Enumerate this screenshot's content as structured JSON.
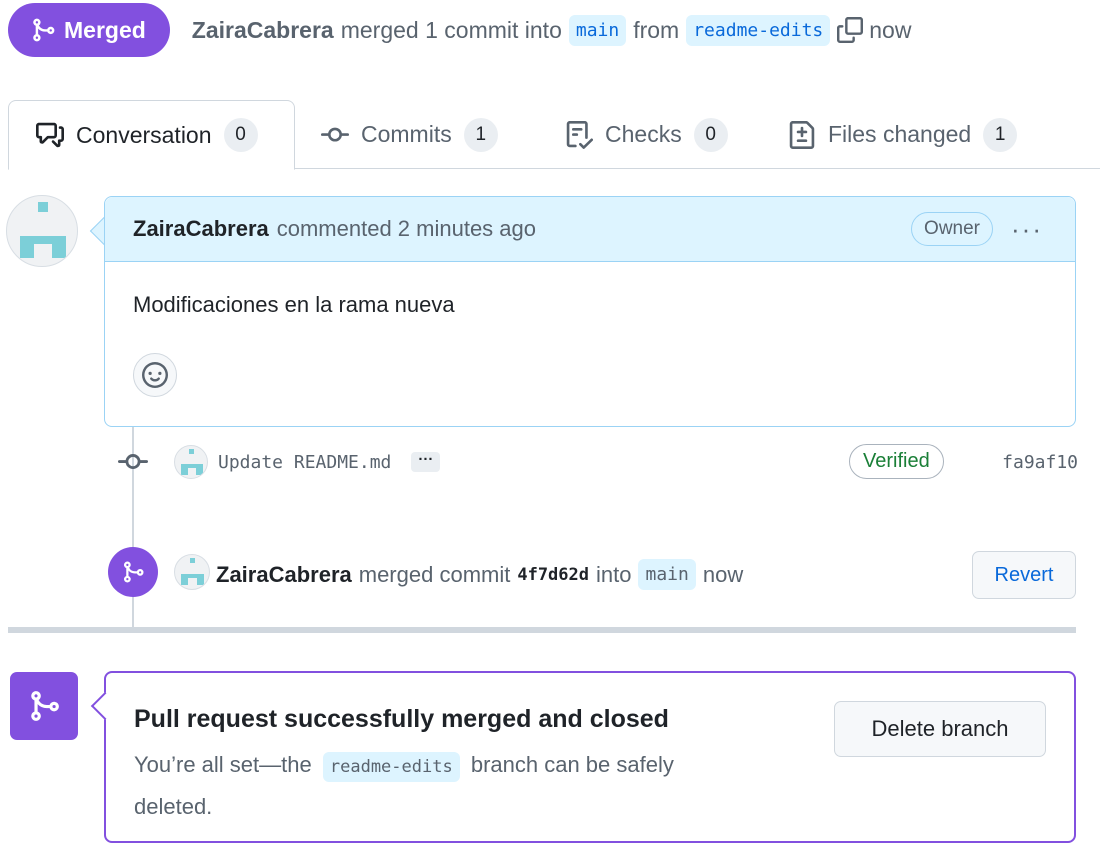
{
  "header": {
    "status_badge": "Merged",
    "author": "ZairaCabrera",
    "merged_text": "merged 1 commit into",
    "base_branch": "main",
    "from_text": "from",
    "head_branch": "readme-edits",
    "time": "now"
  },
  "tabs": [
    {
      "label": "Conversation",
      "count": "0",
      "icon": "comment-discussion-icon"
    },
    {
      "label": "Commits",
      "count": "1",
      "icon": "git-commit-icon"
    },
    {
      "label": "Checks",
      "count": "0",
      "icon": "checklist-icon"
    },
    {
      "label": "Files changed",
      "count": "1",
      "icon": "file-diff-icon"
    }
  ],
  "comment": {
    "author": "ZairaCabrera",
    "meta": "commented 2 minutes ago",
    "role_badge": "Owner",
    "more_label": "···",
    "body": "Modificaciones en la rama nueva"
  },
  "commit": {
    "message": "Update README.md",
    "ellipsis": "···",
    "verified_label": "Verified",
    "sha": "fa9af10"
  },
  "merge_event": {
    "author": "ZairaCabrera",
    "text1": "merged commit",
    "sha": "4f7d62d",
    "text2": "into",
    "branch": "main",
    "time": "now",
    "revert_label": "Revert"
  },
  "merged_box": {
    "title": "Pull request successfully merged and closed",
    "desc_pre": "You’re all set—the",
    "branch": "readme-edits",
    "desc_post": "branch can be safely deleted.",
    "delete_label": "Delete branch"
  },
  "colors": {
    "merged_purple": "#8250df",
    "link_blue": "#0969da",
    "comment_header_bg": "#ddf4ff",
    "verified_green": "#1a7f37"
  }
}
